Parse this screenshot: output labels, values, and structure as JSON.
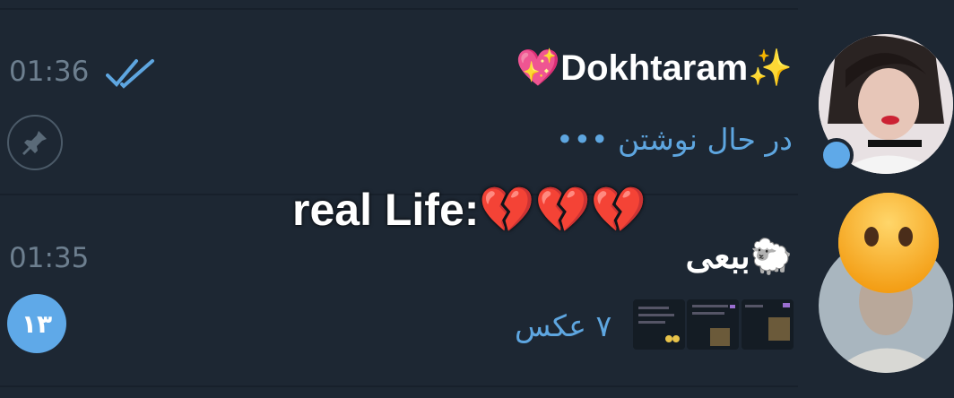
{
  "chats": [
    {
      "name": "Dokhtaram",
      "name_emoji_left": "💖",
      "name_emoji_right": "✨",
      "time": "01:36",
      "status_text": "در حال نوشتن •••",
      "read_state": "double-check",
      "pinned": true
    },
    {
      "name": "ببعی",
      "name_emoji": "🐑",
      "time": "01:35",
      "preview_text": "۷ عکس",
      "unread_count": "۱۳",
      "thumbnail_count": 3
    }
  ],
  "overlay": {
    "text": "real Life:",
    "emojis": "💔💔💔"
  },
  "colors": {
    "background": "#1d2733",
    "accent": "#5fa9e8",
    "muted": "#6d7f8f"
  }
}
